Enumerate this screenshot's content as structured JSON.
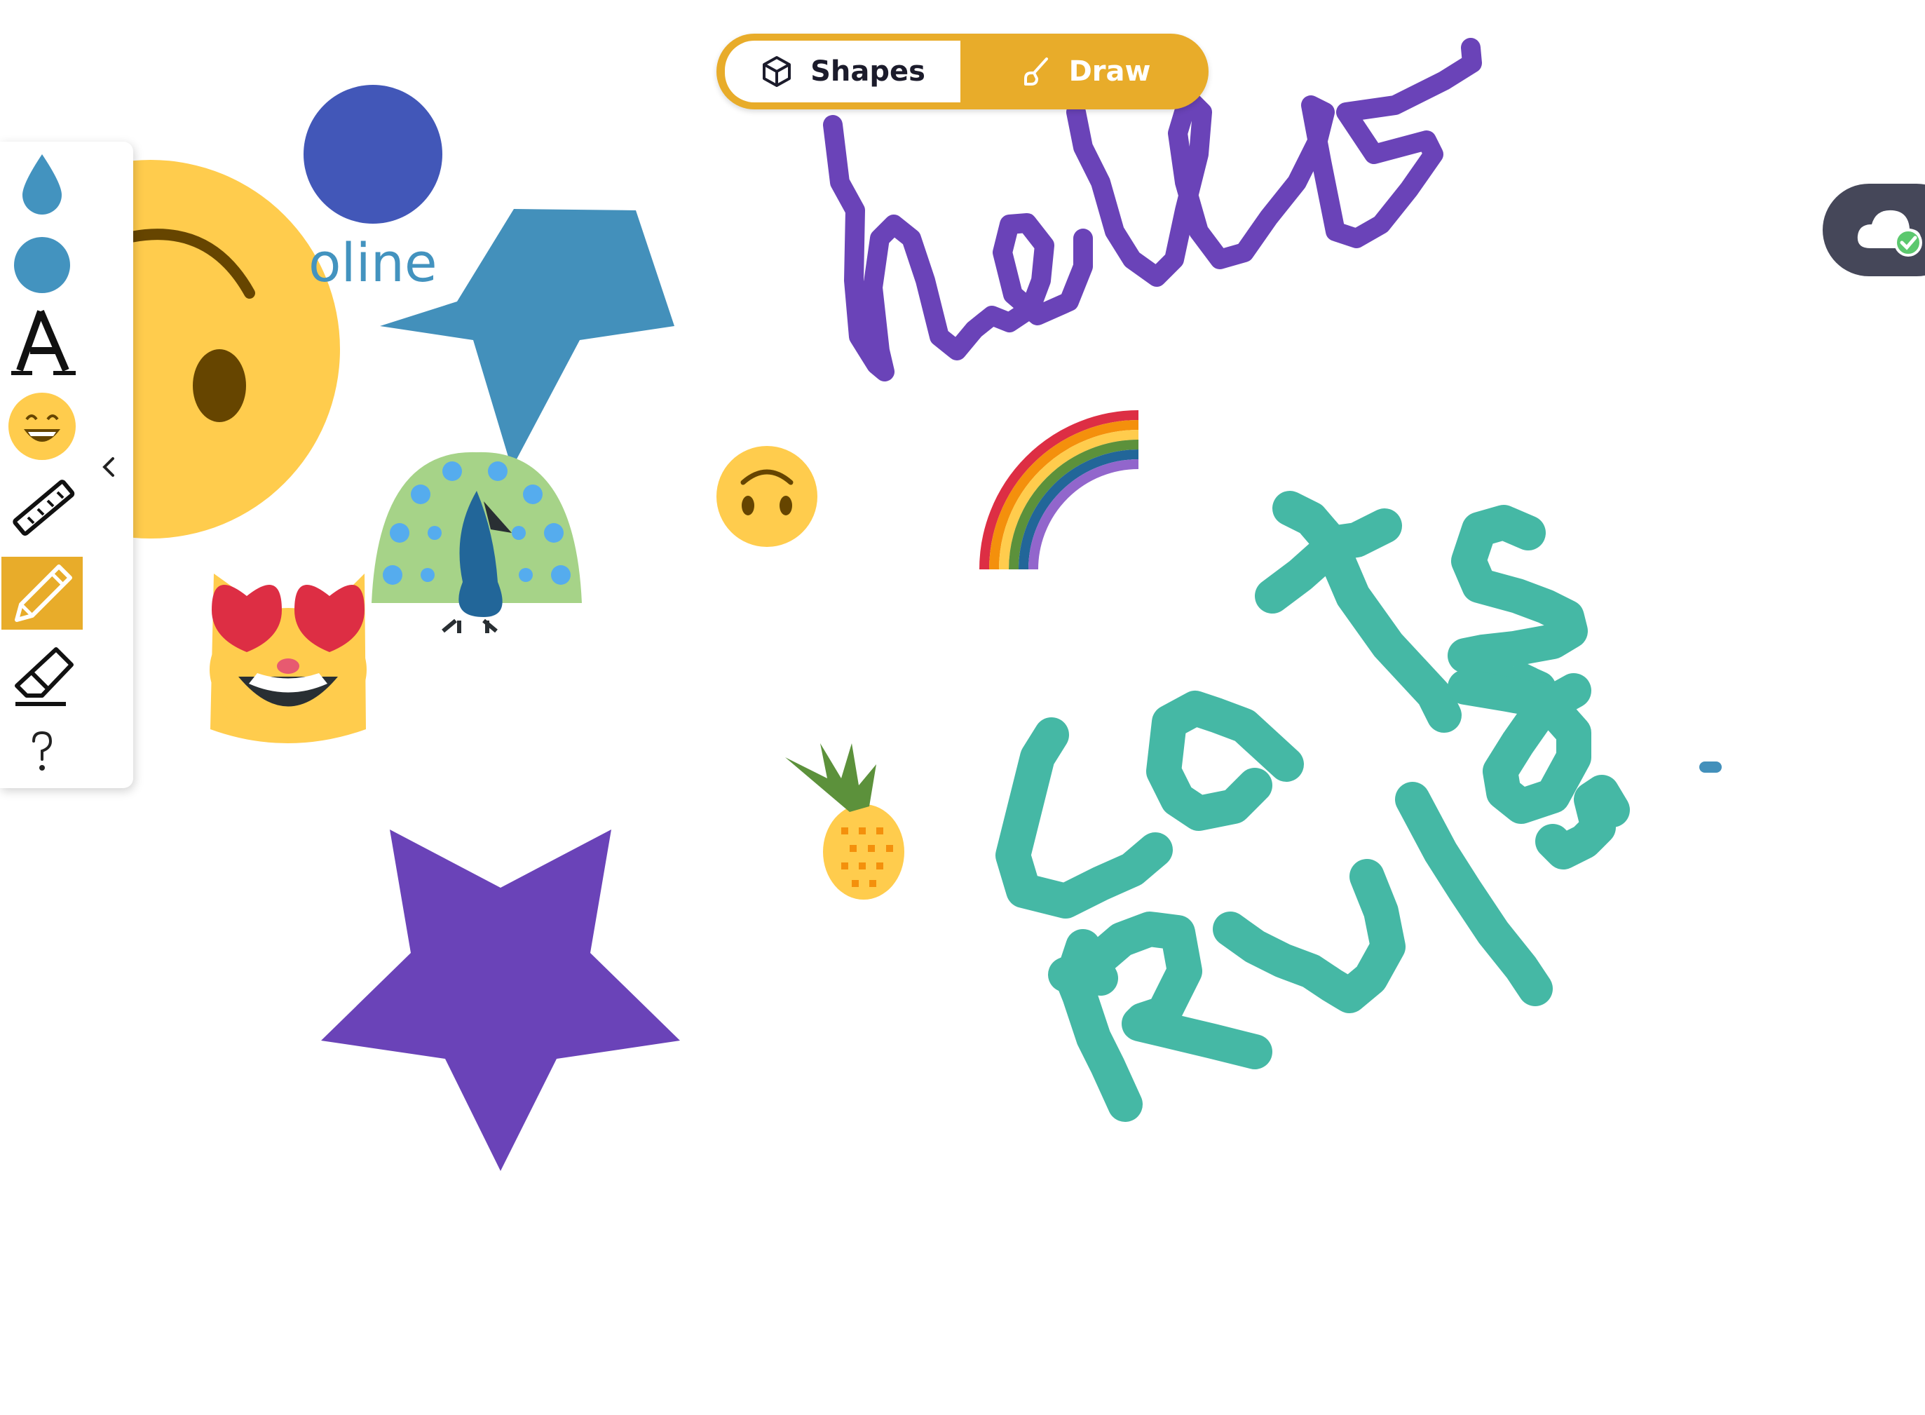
{
  "mode_toggle": {
    "shapes_label": "Shapes",
    "draw_label": "Draw",
    "active": "shapes",
    "colors": {
      "track": "#e8ac2a",
      "active_bg": "#ffffff"
    }
  },
  "toolbar": {
    "items": [
      {
        "name": "fill-color",
        "icon": "droplet-icon"
      },
      {
        "name": "stroke-color",
        "icon": "circle-icon"
      },
      {
        "name": "text",
        "icon": "letter-a-icon"
      },
      {
        "name": "emoji",
        "icon": "grinning-emoji-icon"
      },
      {
        "name": "ruler",
        "icon": "ruler-icon"
      },
      {
        "name": "pencil",
        "icon": "pencil-icon",
        "active": true
      },
      {
        "name": "eraser",
        "icon": "eraser-icon"
      },
      {
        "name": "help",
        "icon": "question-mark-icon"
      }
    ],
    "collapse_icon": "chevron-left-icon",
    "accent": "#e8ac2a"
  },
  "canvas": {
    "text_fragment": "oline",
    "handwriting": [
      "hello",
      "Cats Rule"
    ],
    "colors": {
      "purple": "#6a43b8",
      "teal": "#45b8a5",
      "blue": "#4390bb",
      "navy": "#4257b8",
      "yellow": "#ffcc4d"
    },
    "stickers": [
      "upside-down-face",
      "smiling-cat-heart-eyes",
      "peacock",
      "rainbow",
      "pineapple"
    ]
  },
  "cloud_status": {
    "icon": "cloud-check-icon",
    "state": "saved"
  }
}
